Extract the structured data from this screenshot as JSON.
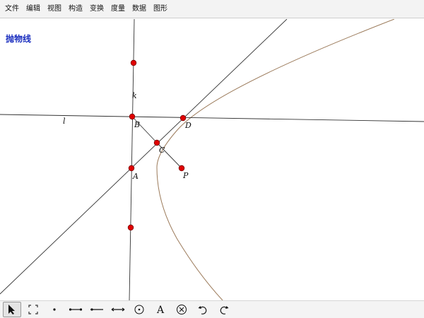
{
  "menu": [
    "文件",
    "编辑",
    "视图",
    "构造",
    "变换",
    "度量",
    "数据",
    "图形"
  ],
  "title": "抛物线",
  "labels": {
    "k": "k",
    "l": "l",
    "B": "B",
    "D": "D",
    "C": "C",
    "A": "A",
    "P": "P"
  },
  "toolbar": [
    {
      "name": "arrow-select-icon",
      "active": true
    },
    {
      "name": "marquee-select-icon",
      "active": false
    },
    {
      "name": "point-tool-icon",
      "active": false
    },
    {
      "name": "segment-tool-icon",
      "active": false
    },
    {
      "name": "ray-tool-icon",
      "active": false
    },
    {
      "name": "line-tool-icon",
      "active": false
    },
    {
      "name": "circle-tool-icon",
      "active": false
    },
    {
      "name": "text-tool-icon",
      "active": false
    },
    {
      "name": "delete-icon",
      "active": false
    },
    {
      "name": "undo-icon",
      "active": false
    },
    {
      "name": "redo-icon",
      "active": false
    }
  ],
  "colors": {
    "point_fill": "#e00000",
    "point_stroke": "#7a0000",
    "line": "#333333",
    "parabola": "#9b7a5a",
    "title": "#1b2fbf"
  },
  "toolbar_text_glyph": "A"
}
